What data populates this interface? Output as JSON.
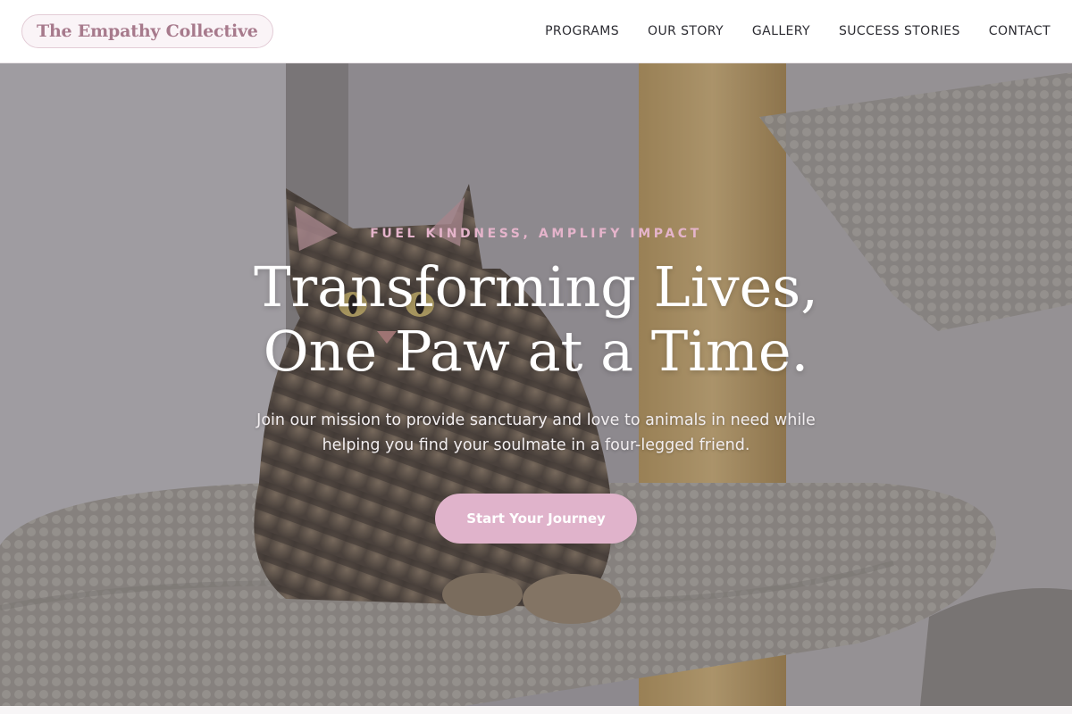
{
  "header": {
    "brand": "The Empathy Collective",
    "nav": [
      {
        "label": "PROGRAMS"
      },
      {
        "label": "OUR STORY"
      },
      {
        "label": "GALLERY"
      },
      {
        "label": "SUCCESS STORIES"
      },
      {
        "label": "CONTACT"
      }
    ]
  },
  "hero": {
    "eyebrow": "FUEL KINDNESS, AMPLIFY IMPACT",
    "headline": "Transforming Lives, One Paw at a Time.",
    "subtitle": "Join our mission to provide sanctuary and love to animals in need while helping you find your soulmate in a four-legged friend.",
    "cta_label": "Start Your Journey"
  },
  "colors": {
    "brand_text": "#a77a8c",
    "accent_pink": "#e0b3cb",
    "eyebrow_pink": "#e5b4cb",
    "nav_text": "#2d2d33"
  }
}
